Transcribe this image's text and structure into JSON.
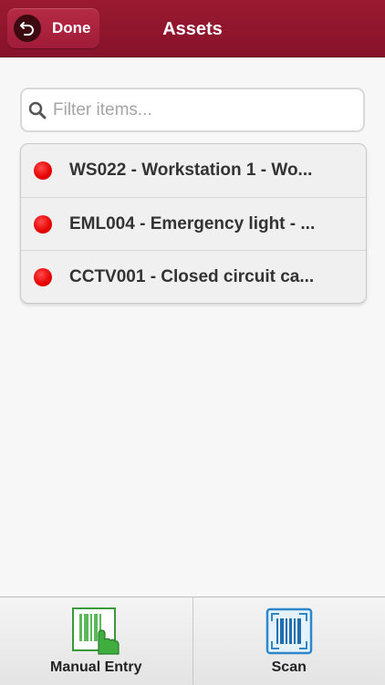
{
  "header": {
    "title": "Assets",
    "done_label": "Done"
  },
  "search": {
    "placeholder": "Filter items..."
  },
  "items": [
    {
      "label": "WS022 - Workstation 1 - Wo...",
      "status_color": "#e60000"
    },
    {
      "label": "EML004 - Emergency light - ...",
      "status_color": "#e60000"
    },
    {
      "label": "CCTV001 - Closed circuit ca...",
      "status_color": "#e60000"
    }
  ],
  "tabbar": {
    "manual_entry_label": "Manual Entry",
    "scan_label": "Scan"
  },
  "colors": {
    "header_bg": "#8e1630",
    "status_red": "#e60000"
  }
}
